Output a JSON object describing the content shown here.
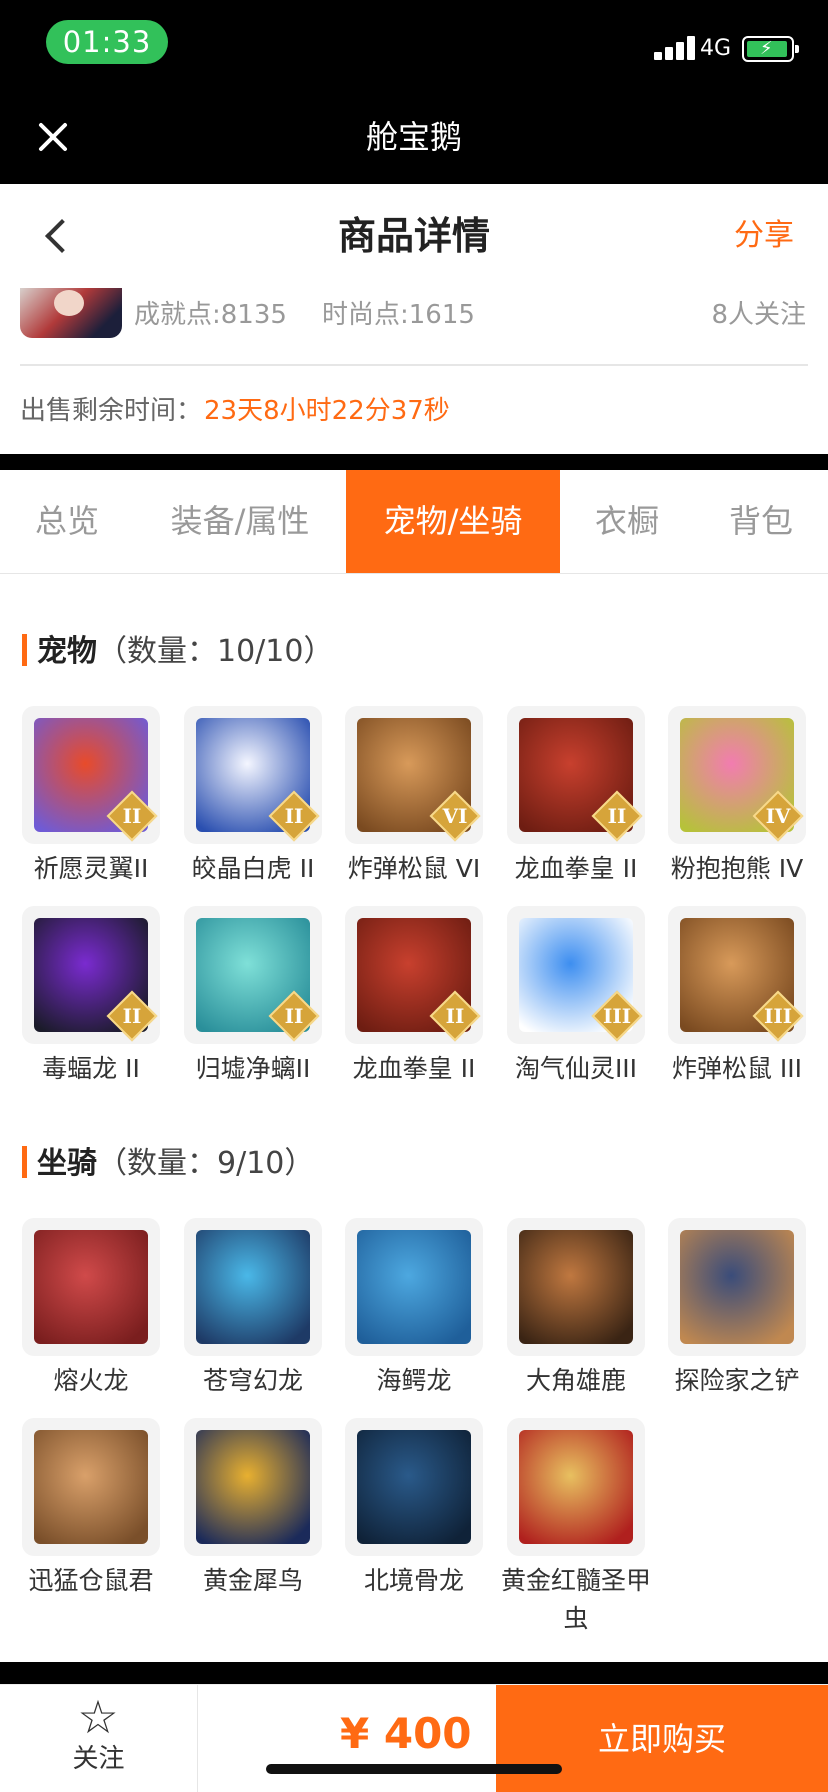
{
  "status_bar": {
    "time": "01:33",
    "network": "4G"
  },
  "app_bar": {
    "title": "舱宝鹅"
  },
  "header": {
    "title": "商品详情",
    "share_label": "分享",
    "achievement": "成就点:8135",
    "fashion": "时尚点:1615",
    "followers": "8人关注",
    "remaining_label": "出售剩余时间：",
    "remaining_value": "23天8小时22分37秒"
  },
  "tabs": [
    {
      "label": "总览",
      "active": false
    },
    {
      "label": "装备/属性",
      "active": false
    },
    {
      "label": "宠物/坐骑",
      "active": true
    },
    {
      "label": "衣橱",
      "active": false
    },
    {
      "label": "背包",
      "active": false
    }
  ],
  "pets": {
    "title": "宠物",
    "count": "（数量：10/10）",
    "items": [
      {
        "label": "祈愿灵翼II",
        "rank": "II",
        "colors": [
          "#e84b2a",
          "#6f5bd6"
        ]
      },
      {
        "label": "皎晶白虎 II",
        "rank": "II",
        "colors": [
          "#f4f6ff",
          "#2a4fb0"
        ]
      },
      {
        "label": "炸弹松鼠 VI",
        "rank": "VI",
        "colors": [
          "#d89a5a",
          "#7a4a20"
        ]
      },
      {
        "label": "龙血拳皇 II",
        "rank": "II",
        "colors": [
          "#c8402e",
          "#6e1d12"
        ]
      },
      {
        "label": "粉抱抱熊 IV",
        "rank": "IV",
        "colors": [
          "#f27cb0",
          "#b6c23a"
        ]
      },
      {
        "label": "毒蝠龙 II",
        "rank": "II",
        "colors": [
          "#7a2bd0",
          "#1b1b2a"
        ]
      },
      {
        "label": "归墟净螭II",
        "rank": "II",
        "colors": [
          "#7fe0d8",
          "#2a8f9a"
        ]
      },
      {
        "label": "龙血拳皇 II",
        "rank": "II",
        "colors": [
          "#c8402e",
          "#6e1d12"
        ]
      },
      {
        "label": "淘气仙灵III",
        "rank": "III",
        "colors": [
          "#3d8ef0",
          "#ffffff"
        ]
      },
      {
        "label": "炸弹松鼠 III",
        "rank": "III",
        "colors": [
          "#d89a5a",
          "#7a4a20"
        ]
      }
    ]
  },
  "mounts": {
    "title": "坐骑",
    "count": "（数量：9/10）",
    "items": [
      {
        "label": "熔火龙",
        "colors": [
          "#d04a4a",
          "#7a1e1e"
        ]
      },
      {
        "label": "苍穹幻龙",
        "colors": [
          "#4ab8e8",
          "#1e3a66"
        ]
      },
      {
        "label": "海鳄龙",
        "colors": [
          "#4da8e0",
          "#1f5f9a"
        ]
      },
      {
        "label": "大角雄鹿",
        "colors": [
          "#c07840",
          "#3a2414"
        ]
      },
      {
        "label": "探险家之铲",
        "colors": [
          "#3a4c7a",
          "#c08850"
        ]
      },
      {
        "label": "迅猛仓鼠君",
        "colors": [
          "#d9a06a",
          "#7a4f2a"
        ]
      },
      {
        "label": "黄金犀鸟",
        "colors": [
          "#e8b030",
          "#1b2a5a"
        ]
      },
      {
        "label": "北境骨龙",
        "colors": [
          "#2a5a8a",
          "#0f2238"
        ]
      },
      {
        "label": "黄金红髓圣甲虫",
        "colors": [
          "#e8c060",
          "#b0201e"
        ]
      }
    ]
  },
  "action_bar": {
    "follow_label": "关注",
    "price": "¥ 400",
    "buy_label": "立即购买"
  },
  "colors": {
    "accent": "#ff6a13",
    "status_green": "#32c15a"
  },
  "icons": {
    "close": "close-icon",
    "back": "back-icon",
    "star": "star-icon"
  }
}
